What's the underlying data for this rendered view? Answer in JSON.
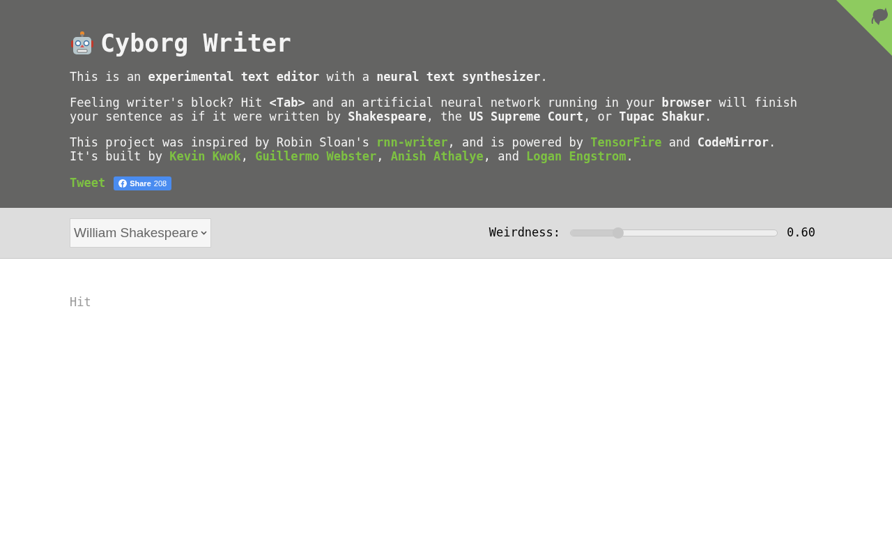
{
  "header": {
    "title": "Cyborg Writer",
    "paragraphs": [
      {
        "lines": [
          [
            {
              "kind": "plain",
              "text": "This is an "
            },
            {
              "kind": "bold",
              "text": "experimental text editor"
            },
            {
              "kind": "plain",
              "text": " with a "
            },
            {
              "kind": "bold",
              "text": "neural text synthesizer"
            },
            {
              "kind": "plain",
              "text": "."
            }
          ]
        ]
      },
      {
        "lines": [
          [
            {
              "kind": "plain",
              "text": "Feeling writer's block? Hit "
            },
            {
              "kind": "bold",
              "text": "<Tab>"
            },
            {
              "kind": "plain",
              "text": " and an artificial neural network running in your "
            },
            {
              "kind": "bold",
              "text": "browser"
            },
            {
              "kind": "plain",
              "text": " will finish your sentence as if it were written by "
            },
            {
              "kind": "bold",
              "text": "Shakespeare"
            },
            {
              "kind": "plain",
              "text": ", the "
            },
            {
              "kind": "bold",
              "text": "US Supreme Court"
            },
            {
              "kind": "plain",
              "text": ", or "
            },
            {
              "kind": "bold",
              "text": "Tupac Shakur"
            },
            {
              "kind": "plain",
              "text": "."
            }
          ]
        ]
      },
      {
        "lines": [
          [
            {
              "kind": "plain",
              "text": "This project was inspired by Robin Sloan's "
            },
            {
              "kind": "link",
              "text": "rnn-writer"
            },
            {
              "kind": "plain",
              "text": ", and is powered by "
            },
            {
              "kind": "link",
              "text": "TensorFire"
            },
            {
              "kind": "plain",
              "text": " and "
            },
            {
              "kind": "bold",
              "text": "CodeMirror"
            },
            {
              "kind": "plain",
              "text": "."
            }
          ],
          [
            {
              "kind": "plain",
              "text": "It's built by "
            },
            {
              "kind": "link",
              "text": "Kevin Kwok"
            },
            {
              "kind": "plain",
              "text": ", "
            },
            {
              "kind": "link",
              "text": "Guillermo Webster"
            },
            {
              "kind": "plain",
              "text": ", "
            },
            {
              "kind": "link",
              "text": "Anish Athalye"
            },
            {
              "kind": "plain",
              "text": ", and "
            },
            {
              "kind": "link",
              "text": "Logan Engstrom"
            },
            {
              "kind": "plain",
              "text": "."
            }
          ]
        ]
      }
    ],
    "tweet": "Tweet",
    "share": {
      "label": "Share",
      "count": "208"
    }
  },
  "toolbar": {
    "model": "William Shakespeare",
    "weirdness": {
      "label": "Weirdness:",
      "level": 0.23,
      "reading": "0.60"
    }
  },
  "editor": {
    "placeholder": "Hit"
  }
}
